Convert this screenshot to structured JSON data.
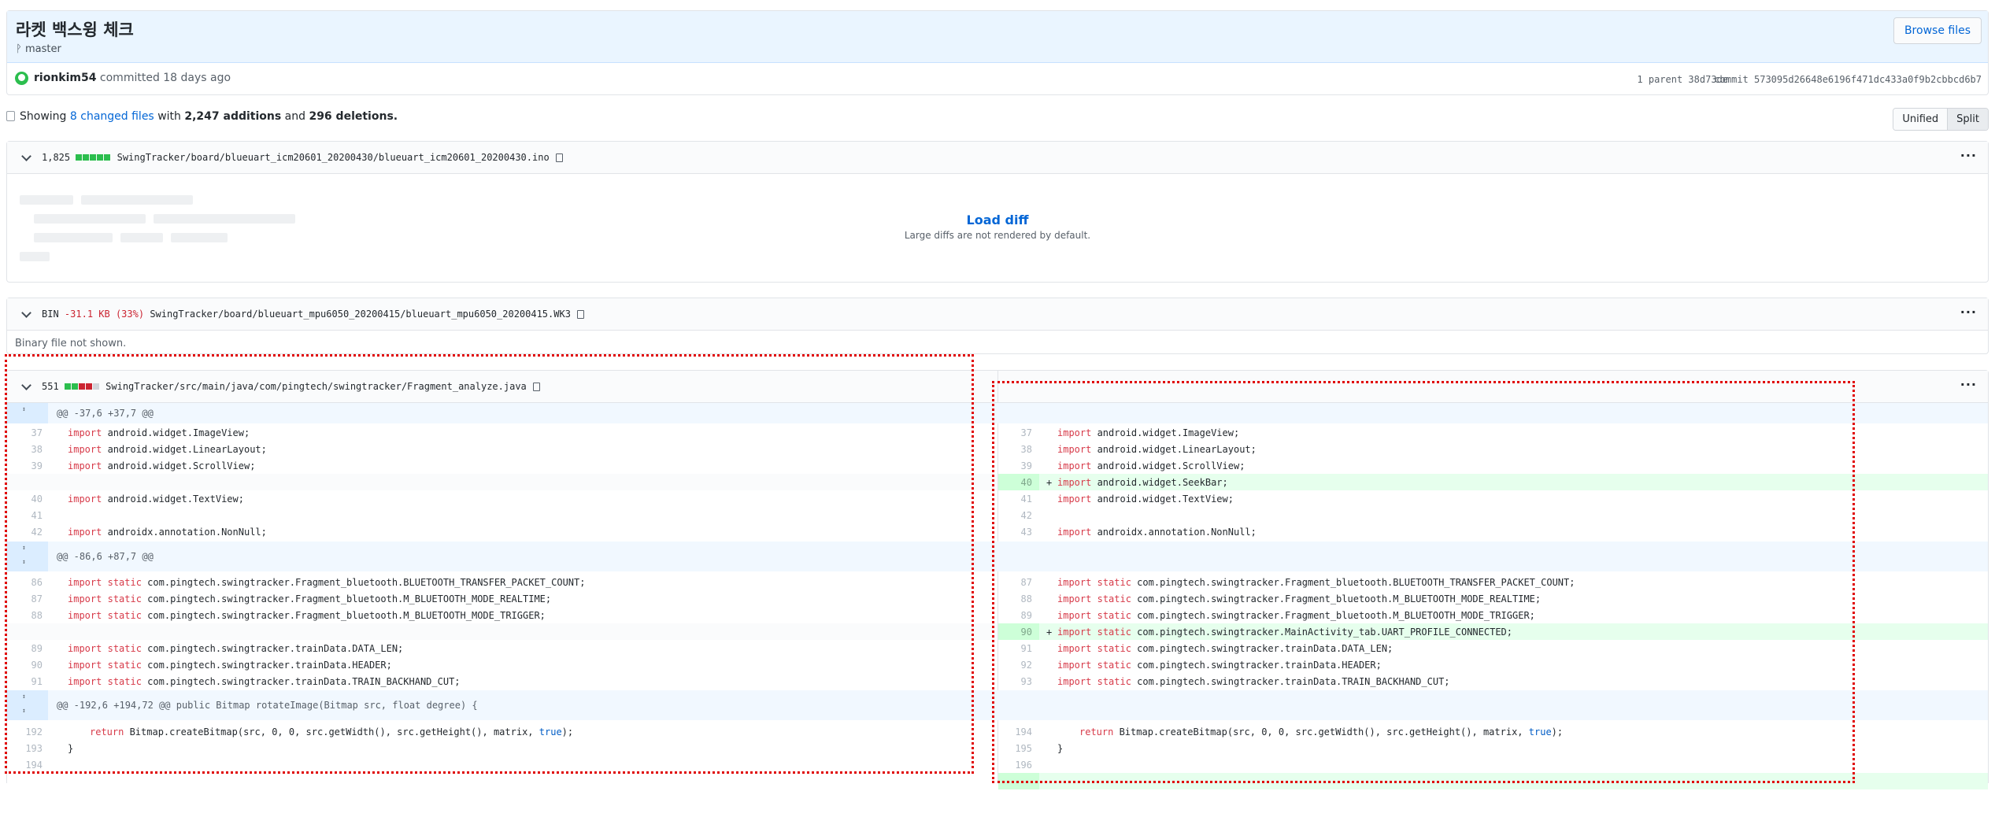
{
  "commit": {
    "title": "라켓 백스윙 체크",
    "branch": "master",
    "browse_files": "Browse files",
    "author": "rionkim54",
    "committed_text": "committed 18 days ago",
    "parent_info": "1 parent 38d73de",
    "sha": "commit 573095d26648e6196f471dc433a0f9b2cbbcd6b7"
  },
  "summary": {
    "showing": "Showing",
    "changed_files": "8 changed files",
    "with": "with",
    "additions": "2,247 additions",
    "and": "and",
    "deletions": "296 deletions."
  },
  "view_toggle": {
    "unified": "Unified",
    "split": "Split"
  },
  "files": [
    {
      "count": "1,825",
      "path": "SwingTracker/board/blueuart_icm20601_20200430/blueuart_icm20601_20200430.ino",
      "load_diff": "Load diff",
      "note": "Large diffs are not rendered by default."
    },
    {
      "count": "BIN",
      "size": "-31.1 KB (33%)",
      "path": "SwingTracker/board/blueuart_mpu6050_20200415/blueuart_mpu6050_20200415.WK3",
      "note": "Binary file not shown."
    },
    {
      "count": "551",
      "path": "SwingTracker/src/main/java/com/pingtech/swingtracker/Fragment_analyze.java"
    }
  ],
  "diff": {
    "hunk1": "@@ -37,6 +37,7 @@",
    "hunk2": "@@ -86,6 +87,7 @@",
    "hunk3": "@@ -192,6 +194,72 @@ public Bitmap rotateImage(Bitmap src, float degree) {",
    "kw_import": "import",
    "kw_static": "static",
    "kw_return": "return",
    "kw_true": "true",
    "plus": "+",
    "left": {
      "n37": "37",
      "n38": "38",
      "n39": "39",
      "n40": "40",
      "n41": "41",
      "n42": "42",
      "n86": "86",
      "n87": "87",
      "n88": "88",
      "n89": "89",
      "n90": "90",
      "n91": "91",
      "n192": "192",
      "n193": "193",
      "n194": "194"
    },
    "right": {
      "n37": "37",
      "n38": "38",
      "n39": "39",
      "n40": "40",
      "n41": "41",
      "n42": "42",
      "n43": "43",
      "n87": "87",
      "n88": "88",
      "n89": "89",
      "n90": "90",
      "n91": "91",
      "n92": "92",
      "n93": "93",
      "n194": "194",
      "n195": "195",
      "n196": "196"
    },
    "code": {
      "imageview": " android.widget.ImageView;",
      "linearlayout": " android.widget.LinearLayout;",
      "scrollview": " android.widget.ScrollView;",
      "seekbar": " android.widget.SeekBar;",
      "textview": " android.widget.TextView;",
      "nonnull": " androidx.annotation.NonNull;",
      "bt_packet": " com.pingtech.swingtracker.Fragment_bluetooth.BLUETOOTH_TRANSFER_PACKET_COUNT;",
      "bt_realtime": " com.pingtech.swingtracker.Fragment_bluetooth.M_BLUETOOTH_MODE_REALTIME;",
      "bt_trigger": " com.pingtech.swingtracker.Fragment_bluetooth.M_BLUETOOTH_MODE_TRIGGER;",
      "uart": " com.pingtech.swingtracker.MainActivity_tab.UART_PROFILE_CONNECTED;",
      "datalen": " com.pingtech.swingtracker.trainData.DATA_LEN;",
      "header": " com.pingtech.swingtracker.trainData.HEADER;",
      "backhand": " com.pingtech.swingtracker.trainData.TRAIN_BACKHAND_CUT;",
      "return_pre": " Bitmap.createBitmap(src, 0, 0, src.getWidth(), src.getHeight(), matrix, ",
      "return_post": ");",
      "close": "}"
    }
  },
  "colors": {
    "accent": "#0366d6",
    "addition": "#2cbe4e",
    "deletion": "#cb2431",
    "annotation": "#e00000"
  }
}
